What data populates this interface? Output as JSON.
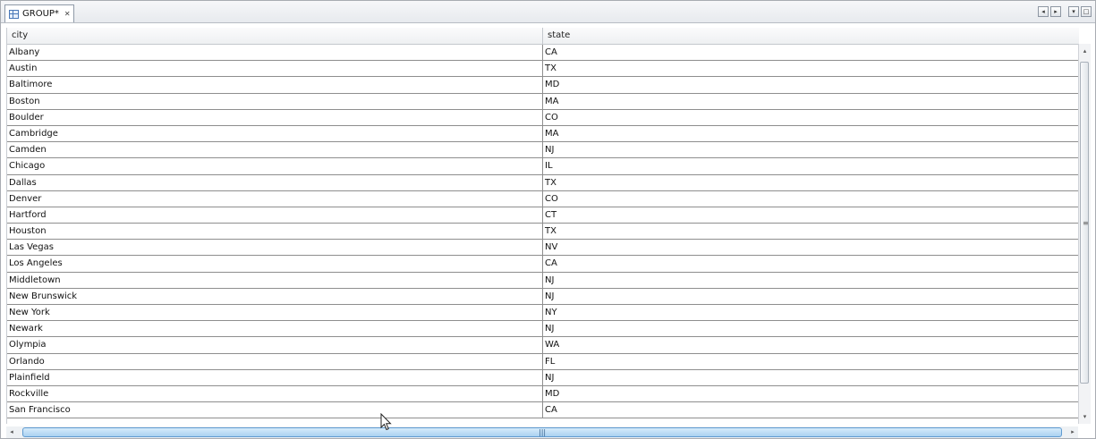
{
  "tab": {
    "title": "GROUP*",
    "icon": "table-icon",
    "close_glyph": "✕"
  },
  "window_controls": {
    "left_glyph": "◂",
    "right_glyph": "▸",
    "menu_glyph": "▾",
    "maximize_glyph": "□"
  },
  "grid": {
    "columns": [
      "city",
      "state"
    ],
    "rows": [
      [
        "Albany",
        "CA"
      ],
      [
        "Austin",
        "TX"
      ],
      [
        "Baltimore",
        "MD"
      ],
      [
        "Boston",
        "MA"
      ],
      [
        "Boulder",
        "CO"
      ],
      [
        "Cambridge",
        "MA"
      ],
      [
        "Camden",
        "NJ"
      ],
      [
        "Chicago",
        "IL"
      ],
      [
        "Dallas",
        "TX"
      ],
      [
        "Denver",
        "CO"
      ],
      [
        "Hartford",
        "CT"
      ],
      [
        "Houston",
        "TX"
      ],
      [
        "Las Vegas",
        "NV"
      ],
      [
        "Los Angeles",
        "CA"
      ],
      [
        "Middletown",
        "NJ"
      ],
      [
        "New Brunswick",
        "NJ"
      ],
      [
        "New York",
        "NY"
      ],
      [
        "Newark",
        "NJ"
      ],
      [
        "Olympia",
        "WA"
      ],
      [
        "Orlando",
        "FL"
      ],
      [
        "Plainfield",
        "NJ"
      ],
      [
        "Rockville",
        "MD"
      ],
      [
        "San Francisco",
        "CA"
      ]
    ]
  },
  "scrollbars": {
    "up_glyph": "▴",
    "down_glyph": "▾",
    "left_glyph": "◂",
    "right_glyph": "▸",
    "vertical_grip": "≡",
    "horizontal_grip": "|||"
  },
  "colors": {
    "tab_icon": "#4a78b8",
    "scroll_thumb": "#a9d0f0",
    "row_divider": "#8e8e8e"
  }
}
